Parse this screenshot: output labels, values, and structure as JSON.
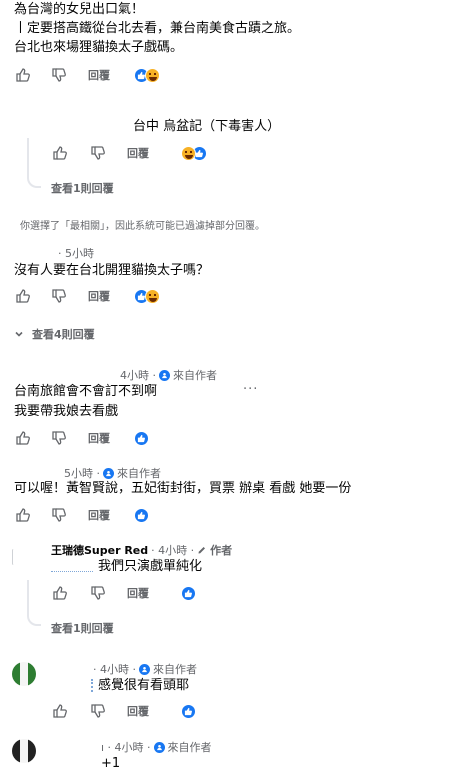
{
  "post": {
    "line1": "為台灣的女兒出口氣！",
    "line2": "丨定要搭高鐵從台北去看，兼台南美食古蹟之旅。",
    "line3": "台北也來場狸貓換太子戲碼。"
  },
  "actions": {
    "reply_label": "回覆"
  },
  "reply_1": {
    "text": "台中 烏盆記（下毒害人）"
  },
  "view_1_reply": "查看1則回覆",
  "filter_notice": "你選擇了「最相關」，因此系統可能已過濾掉部分回覆。",
  "comment_2": {
    "time": "· 5小時",
    "text": "沒有人要在台北開狸貓換太子嗎？"
  },
  "view_4_replies": "查看4則回覆",
  "comment_3": {
    "meta": "4小時 ·",
    "author_label": "來自作者",
    "line1": "台南旅館會不會訂不到啊",
    "line2": "我要帶我娘去看戲",
    "more": "···"
  },
  "comment_4": {
    "meta": "5小時 ·",
    "author_label": "來自作者",
    "text": "可以喔！黃智賢說，五妃街封街，買票 辦桌 看戲 她要一份"
  },
  "comment_5": {
    "name": "王瑞德Super Red",
    "time": "· 4小時 ·",
    "author_label": "作者",
    "text": "我們只演戲單純化"
  },
  "comment_6": {
    "meta": "· 4小時 ·",
    "author_label": "來自作者",
    "text": "感覺很有看頭耶"
  },
  "comment_7": {
    "meta": "ı · 4小時 ·",
    "author_label": "來自作者",
    "text": "+1"
  },
  "icons": {
    "like": "thumb-up-icon",
    "dislike": "thumb-down-icon"
  },
  "colors": {
    "accent": "#1877f2",
    "muted": "#65676b",
    "haha": "#f7b125"
  }
}
